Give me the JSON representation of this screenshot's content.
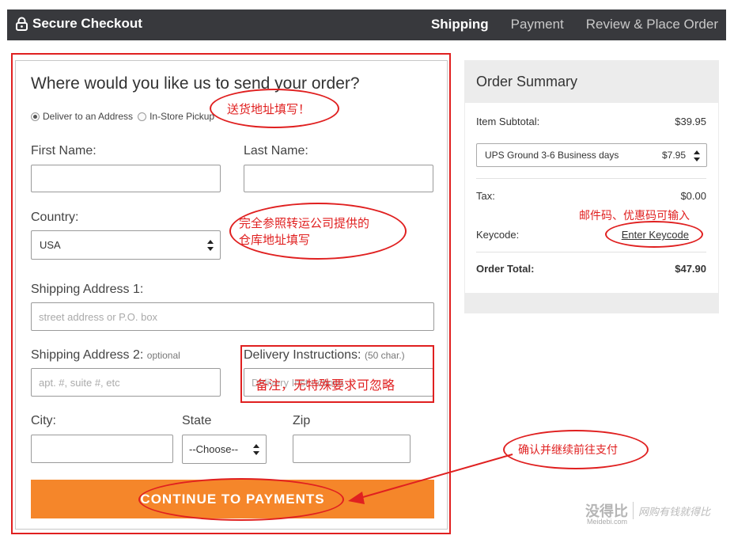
{
  "header": {
    "brand": "Secure Checkout",
    "steps": [
      {
        "label": "Shipping",
        "active": true
      },
      {
        "label": "Payment",
        "active": false
      },
      {
        "label": "Review & Place Order",
        "active": false
      }
    ]
  },
  "form": {
    "title": "Where would you like us to send your order?",
    "delivery_options": [
      {
        "label": "Deliver to an Address",
        "selected": true
      },
      {
        "label": "In-Store Pickup",
        "selected": false
      }
    ],
    "first_name_label": "First Name:",
    "last_name_label": "Last Name:",
    "country_label": "Country:",
    "country_value": "USA",
    "address1_label": "Shipping Address 1:",
    "address1_placeholder": "street address or P.O. box",
    "address2_label": "Shipping Address 2:",
    "address2_optional": "optional",
    "address2_placeholder": "apt. #, suite #, etc",
    "instructions_label": "Delivery Instructions:",
    "instructions_hint": "(50 char.)",
    "instructions_placeholder": "Delivery Instructions",
    "city_label": "City:",
    "state_label": "State",
    "state_value": "--Choose--",
    "zip_label": "Zip",
    "continue_label": "CONTINUE TO PAYMENTS"
  },
  "summary": {
    "title": "Order Summary",
    "subtotal_label": "Item Subtotal:",
    "subtotal_value": "$39.95",
    "shipping_option": "UPS Ground 3-6 Business days",
    "shipping_price": "$7.95",
    "tax_label": "Tax:",
    "tax_value": "$0.00",
    "keycode_label": "Keycode:",
    "keycode_link": "Enter Keycode",
    "total_label": "Order Total:",
    "total_value": "$47.90"
  },
  "annotations": {
    "address_note": "送货地址填写！",
    "country_note_line1": "完全参照转运公司提供的",
    "country_note_line2": "仓库地址填写",
    "instructions_note": "备注，无特殊要求可忽略",
    "keycode_note": "邮件码、优惠码可输入",
    "continue_note": "确认并继续前往支付",
    "accent_color": "#e02020"
  },
  "watermark": {
    "brand": "没得比",
    "domain": "Meidebi.com",
    "slogan": "网购有钱就得比"
  },
  "colors": {
    "topbar": "#38393d",
    "cta": "#f5862a",
    "summary_bg": "#ececec"
  }
}
